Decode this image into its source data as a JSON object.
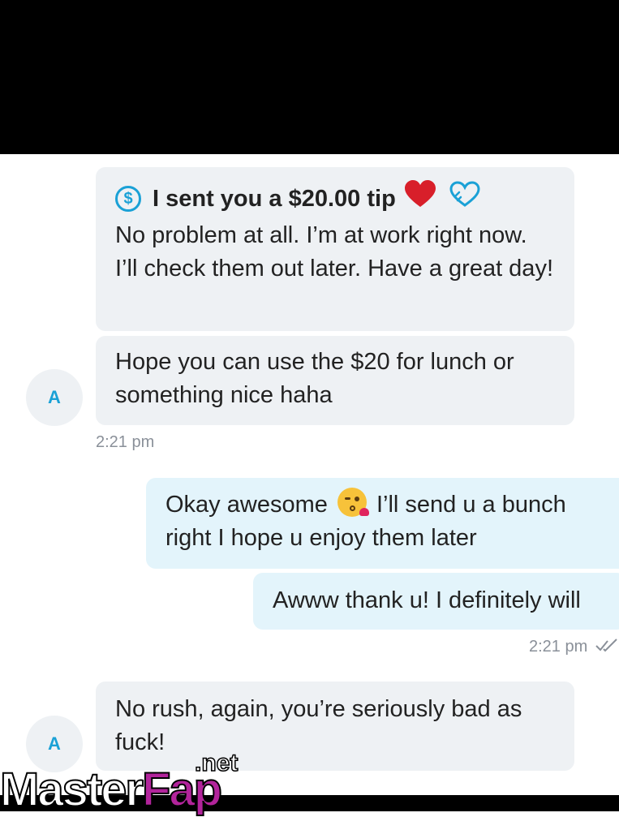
{
  "colors": {
    "accent": "#1aa1d6",
    "incoming_bubble": "#eef1f4",
    "outgoing_bubble": "#e3f4fb",
    "heart": "#d81f2a",
    "watermark_fap": "#b2249b"
  },
  "avatar_initial": "A",
  "messages": [
    {
      "tip_text": "I sent you a $20.00 tip",
      "text": "No problem at all. I’m at work right now. I’ll check them out later. Have a great day!"
    },
    {
      "text": "Hope you can use the $20 for lunch or something nice haha"
    },
    {
      "time": "2:21 pm"
    },
    {
      "text_before_emoji": "Okay awesome",
      "text_after_emoji": "I’ll send u a bunch right I hope u enjoy them later"
    },
    {
      "text": "Awww thank u! I definitely will"
    },
    {
      "time": "2:21 pm"
    },
    {
      "text": "No rush, again, you’re seriously bad as fuck!"
    }
  ],
  "icons": {
    "tip": "dollar-circle-icon",
    "heart": "red-heart-icon",
    "tip_react": "outline-heart-icon",
    "emoji": "kissing-face-emoji",
    "read": "double-check-icon"
  },
  "watermark": {
    "master": "Master",
    "fap": "Fap",
    "net": ".net"
  }
}
